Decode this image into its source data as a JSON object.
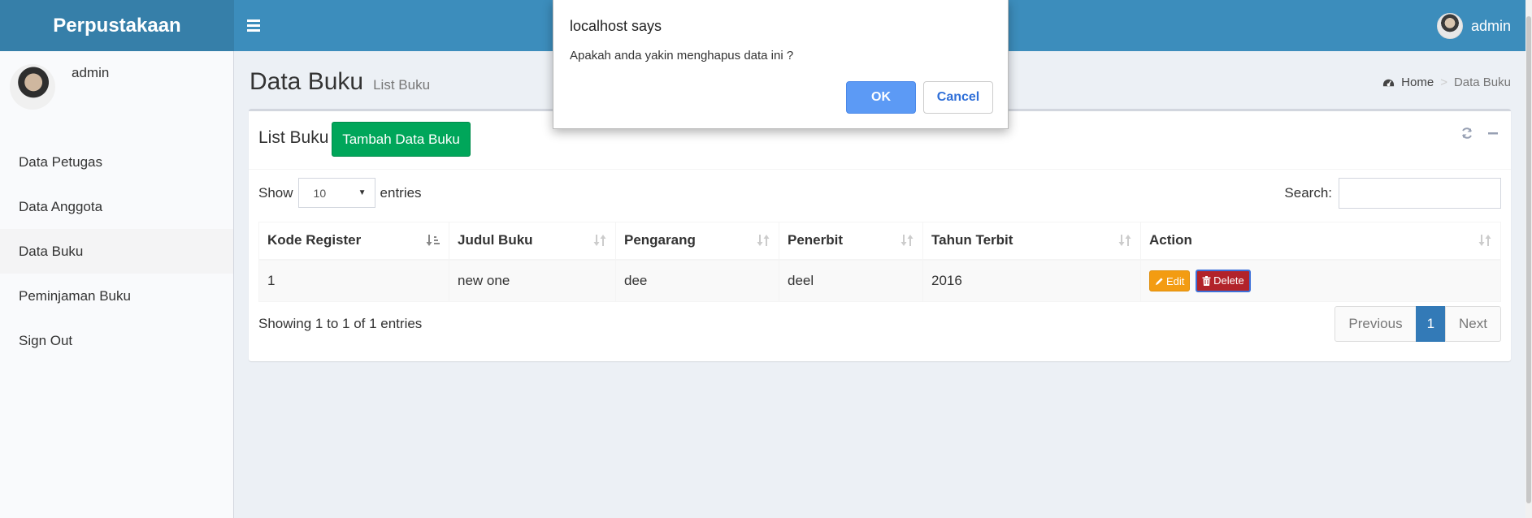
{
  "app": {
    "logo": "Perpustakaan",
    "user_name": "admin"
  },
  "sidebar": {
    "user_name": "admin",
    "items": [
      {
        "label": "Data Petugas",
        "active": false
      },
      {
        "label": "Data Anggota",
        "active": false
      },
      {
        "label": "Data Buku",
        "active": true
      },
      {
        "label": "Peminjaman Buku",
        "active": false
      },
      {
        "label": "Sign Out",
        "active": false
      }
    ]
  },
  "content": {
    "title": "Data Buku",
    "subtitle": "List Buku",
    "breadcrumb": {
      "home": "Home",
      "separator": ">",
      "current": "Data Buku"
    }
  },
  "box": {
    "title": "List Buku",
    "add_button": "Tambah Data Buku",
    "show_label": "Show",
    "page_length": "10",
    "entries_label": "entries",
    "search_label": "Search:",
    "search_value": ""
  },
  "table": {
    "headers": [
      "Kode Register",
      "Judul Buku",
      "Pengarang",
      "Penerbit",
      "Tahun Terbit",
      "Action"
    ],
    "rows": [
      {
        "kode": "1",
        "judul": "new one",
        "pengarang": "dee",
        "penerbit": "deel",
        "tahun": "2016"
      }
    ],
    "edit_label": "Edit",
    "delete_label": "Delete"
  },
  "footer": {
    "info": "Showing 1 to 1 of 1 entries",
    "previous": "Previous",
    "current_page": "1",
    "next": "Next"
  },
  "dialog": {
    "title": "localhost says",
    "message": "Apakah anda yakin menghapus data ini ?",
    "ok": "OK",
    "cancel": "Cancel"
  },
  "colors": {
    "header": "#3c8dbc",
    "logo_bg": "#367fa9",
    "add_button": "#00a65a",
    "edit_button": "#f39c12",
    "delete_button": "#b2232a",
    "pagination_active": "#337ab7",
    "dialog_ok": "#5c9af5"
  }
}
